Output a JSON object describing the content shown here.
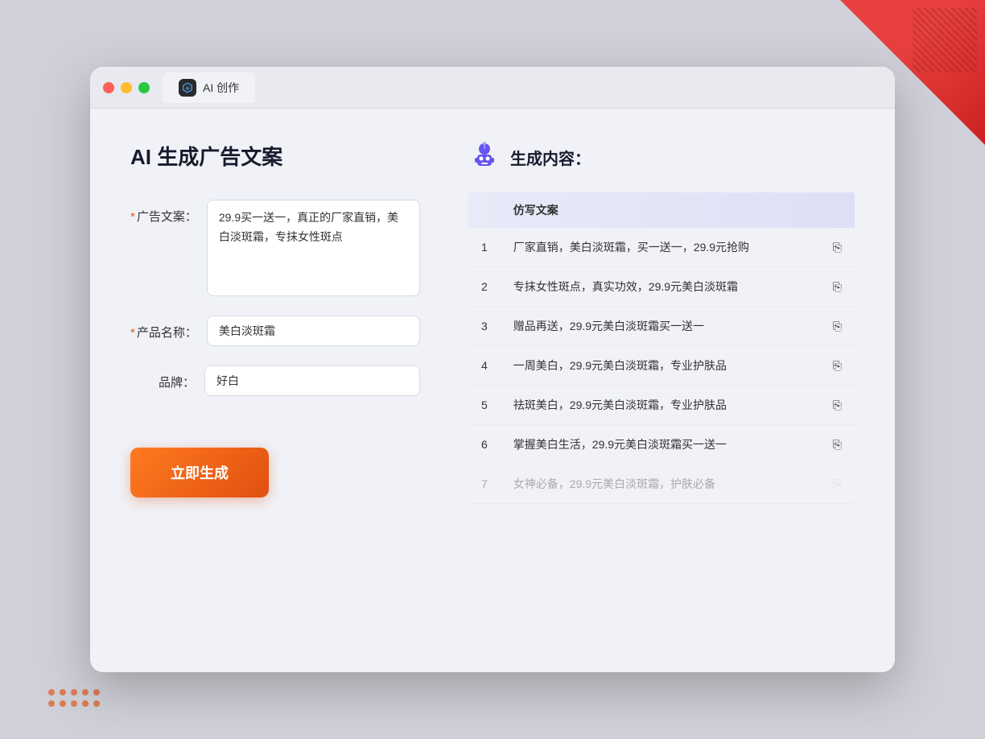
{
  "window": {
    "tab_label": "AI 创作"
  },
  "page": {
    "title": "AI 生成广告文案",
    "right_title": "生成内容："
  },
  "form": {
    "ad_copy_label": "广告文案：",
    "ad_copy_required": "*",
    "ad_copy_value": "29.9买一送一，真正的厂家直销，美白淡斑霜，专抹女性斑点",
    "product_name_label": "产品名称：",
    "product_name_required": "*",
    "product_name_value": "美白淡斑霜",
    "brand_label": "品牌：",
    "brand_value": "好白",
    "generate_btn": "立即生成"
  },
  "results": {
    "table_header": "仿写文案",
    "rows": [
      {
        "num": 1,
        "text": "厂家直销，美白淡斑霜，买一送一，29.9元抢购"
      },
      {
        "num": 2,
        "text": "专抹女性斑点，真实功效，29.9元美白淡斑霜"
      },
      {
        "num": 3,
        "text": "赠品再送，29.9元美白淡斑霜买一送一"
      },
      {
        "num": 4,
        "text": "一周美白，29.9元美白淡斑霜，专业护肤品"
      },
      {
        "num": 5,
        "text": "祛斑美白，29.9元美白淡斑霜，专业护肤品"
      },
      {
        "num": 6,
        "text": "掌握美白生活，29.9元美白淡斑霜买一送一"
      },
      {
        "num": 7,
        "text": "女神必备，29.9元美白淡斑霜，护肤必备",
        "dimmed": true
      }
    ]
  }
}
